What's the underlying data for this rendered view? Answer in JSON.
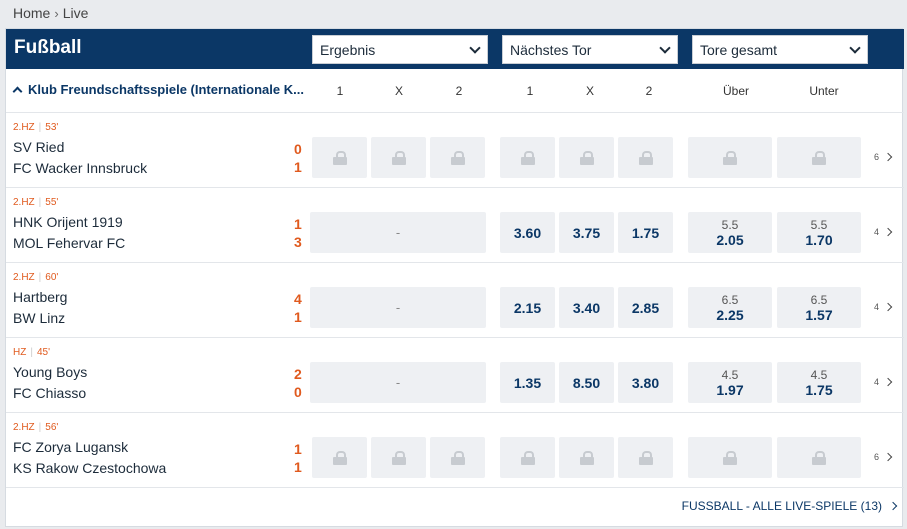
{
  "breadcrumb": {
    "home": "Home",
    "separator": "›",
    "current": "Live"
  },
  "header": {
    "title": "Fußball",
    "selects": [
      "Ergebnis",
      "Nächstes Tor",
      "Tore gesamt"
    ]
  },
  "league": {
    "name": "Klub Freundschaftsspiele (Internationale K..."
  },
  "columns": {
    "result": [
      "1",
      "X",
      "2"
    ],
    "next_goal": [
      "1",
      "X",
      "2"
    ],
    "totals": [
      "Über",
      "Unter"
    ]
  },
  "matches": [
    {
      "period": "2.HZ",
      "minute": "53'",
      "home": "SV Ried",
      "away": "FC Wacker Innsbruck",
      "score_home": "0",
      "score_away": "1",
      "result_locked": true,
      "next_goal": null,
      "over": null,
      "under": null,
      "more": "6"
    },
    {
      "period": "2.HZ",
      "minute": "55'",
      "home": "HNK Orijent 1919",
      "away": "MOL Fehervar FC",
      "score_home": "1",
      "score_away": "3",
      "result_dash": "-",
      "next_goal": [
        "3.60",
        "3.75",
        "1.75"
      ],
      "over": {
        "line": "5.5",
        "odd": "2.05"
      },
      "under": {
        "line": "5.5",
        "odd": "1.70"
      },
      "more": "4"
    },
    {
      "period": "2.HZ",
      "minute": "60'",
      "home": "Hartberg",
      "away": "BW Linz",
      "score_home": "4",
      "score_away": "1",
      "result_dash": "-",
      "next_goal": [
        "2.15",
        "3.40",
        "2.85"
      ],
      "over": {
        "line": "6.5",
        "odd": "2.25"
      },
      "under": {
        "line": "6.5",
        "odd": "1.57"
      },
      "more": "4"
    },
    {
      "period": "HZ",
      "minute": "45'",
      "home": "Young Boys",
      "away": "FC Chiasso",
      "score_home": "2",
      "score_away": "0",
      "result_dash": "-",
      "next_goal": [
        "1.35",
        "8.50",
        "3.80"
      ],
      "over": {
        "line": "4.5",
        "odd": "1.97"
      },
      "under": {
        "line": "4.5",
        "odd": "1.75"
      },
      "more": "4"
    },
    {
      "period": "2.HZ",
      "minute": "56'",
      "home": "FC Zorya Lugansk",
      "away": "KS Rakow Czestochowa",
      "score_home": "1",
      "score_away": "1",
      "result_locked": true,
      "next_goal": null,
      "over": null,
      "under": null,
      "more": "6"
    }
  ],
  "footer": {
    "all_live_link": "FUSSBALL - ALLE LIVE-SPIELE (13)"
  },
  "colors": {
    "header_bg": "#0b3766",
    "accent_orange": "#e05a1e",
    "odd_text": "#0b3766",
    "cell_bg": "#eef0f3"
  }
}
